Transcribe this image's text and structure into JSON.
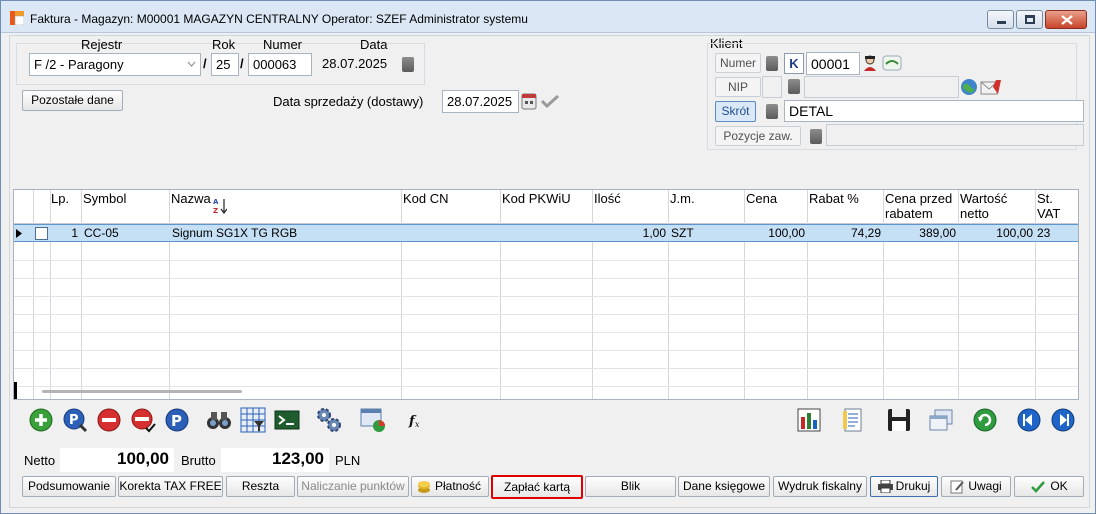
{
  "window": {
    "title": "Faktura - Magazyn: M00001 MAGAZYN CENTRALNY  Operator: SZEF Administrator systemu"
  },
  "header": {
    "rejestr_label": "Rejestr",
    "rok_label": "Rok",
    "numer_label": "Numer",
    "data_label": "Data",
    "rejestr_value": "F /2   - Paragony",
    "rok_value": "25",
    "numer_value": "000063",
    "data_value": "28.07.2025",
    "sep": "/",
    "pozostale_button": "Pozostałe dane",
    "data_sprzedazy_label": "Data sprzedaży (dostawy)",
    "data_sprzedazy_value": "28.07.2025"
  },
  "client": {
    "section_label": "Klient",
    "numer_label": "Numer",
    "k_label": "K",
    "numer_value": "00001",
    "nip_label": "NIP",
    "nip_value": "",
    "skrot_label": "Skrót",
    "skrot_value": "DETAL",
    "pozycje_label": "Pozycje zaw.",
    "pozycje_value": ""
  },
  "grid": {
    "columns": [
      "Lp.",
      "Symbol",
      "Nazwa",
      "Kod  CN",
      "Kod  PKWiU",
      "Ilość",
      "J.m.",
      "Cena",
      "Rabat %",
      "Cena przed rabatem",
      "Wartość netto",
      "St. VAT"
    ],
    "rows": [
      {
        "lp": "1",
        "symbol": "CC-05",
        "nazwa": "Signum SG1X TG RGB",
        "kod_cn": "",
        "kod_pkwiu": "",
        "ilosc": "1,00",
        "jm": "SZT",
        "cena": "100,00",
        "rabat": "74,29",
        "cena_przed": "389,00",
        "wartosc": "100,00",
        "vat": "23"
      }
    ]
  },
  "toolbar_icons": [
    "add-icon",
    "search-icon",
    "remove-icon",
    "remove-check-icon",
    "p-icon",
    "binoculars-icon",
    "grid-filter-icon",
    "export-icon",
    "gears-icon",
    "window-chart-icon",
    "fx-icon",
    "bar-chart-icon",
    "document-list-icon",
    "save-icon",
    "windows-icon",
    "refresh-icon",
    "prev-icon",
    "next-icon"
  ],
  "totals": {
    "netto_label": "Netto",
    "netto_value": "100,00",
    "brutto_label": "Brutto",
    "brutto_value": "123,00",
    "currency": "PLN"
  },
  "buttons": {
    "podsumowanie": "Podsumowanie",
    "korekta": "Korekta TAX FREE",
    "reszta": "Reszta",
    "naliczanie": "Naliczanie punktów",
    "platnosc": "Płatność",
    "zaplac_karta": "Zapłać kartą",
    "blik": "Blik",
    "dane_ksiegowe": "Dane księgowe",
    "wydruk_fiskalny": "Wydruk fiskalny",
    "drukuj": "Drukuj",
    "uwagi": "Uwagi",
    "ok": "OK"
  },
  "colors": {
    "selected_row": "#c5dff5",
    "highlight_border": "#e00000",
    "frame_bg": "#f0f0f0"
  }
}
